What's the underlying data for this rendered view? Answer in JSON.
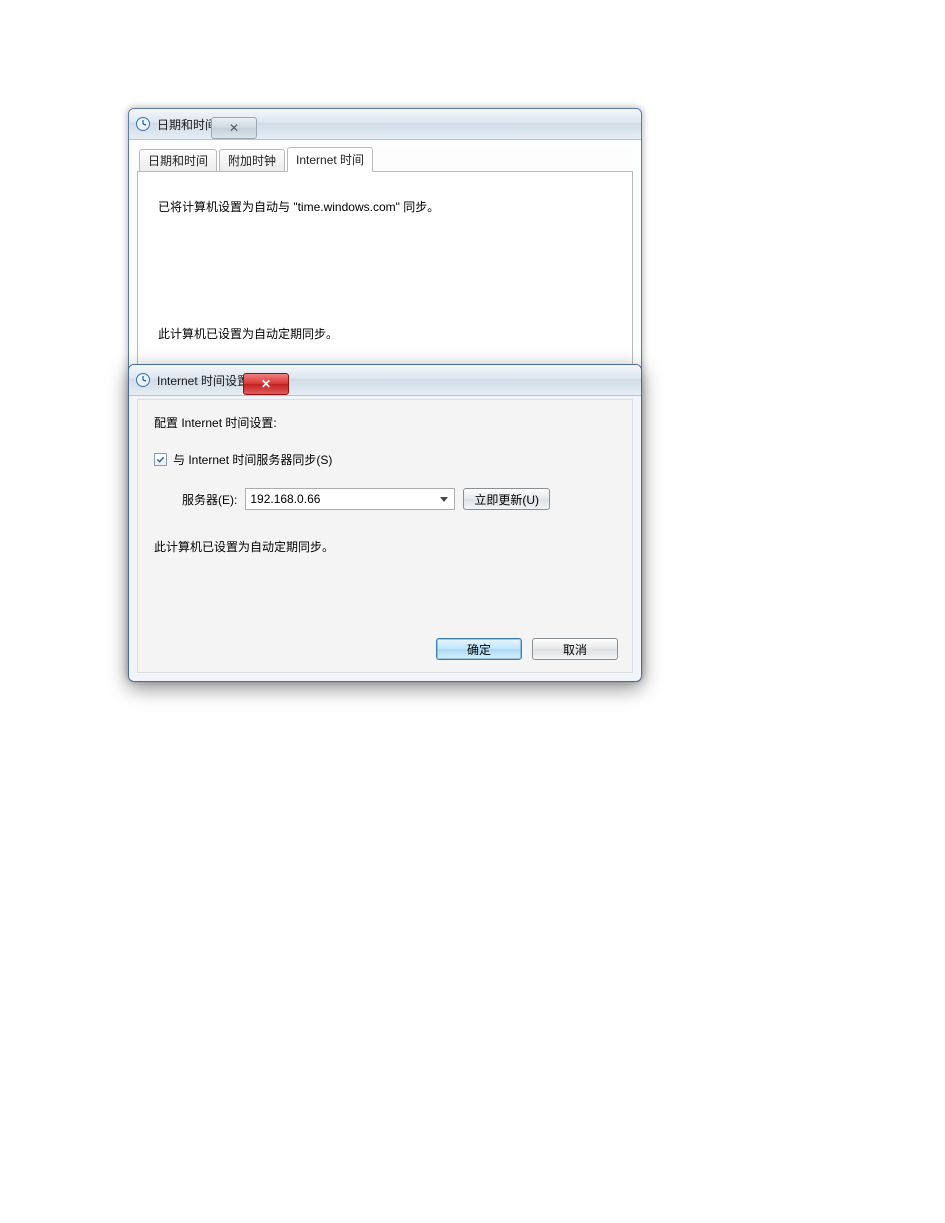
{
  "parent": {
    "title": "日期和时间",
    "close_glyph": "✕",
    "tabs": [
      {
        "label": "日期和时间"
      },
      {
        "label": "附加时钟"
      },
      {
        "label": "Internet 时间"
      }
    ],
    "active_tab_index": 2,
    "panel": {
      "sync_info": "已将计算机设置为自动与 \"time.windows.com\" 同步。",
      "auto_sync_status": "此计算机已设置为自动定期同步。"
    }
  },
  "child": {
    "title": "Internet 时间设置",
    "close_glyph": "✕",
    "config_heading": "配置 Internet 时间设置:",
    "checkbox": {
      "checked": true,
      "label": "与 Internet 时间服务器同步(S)"
    },
    "server": {
      "label": "服务器(E):",
      "value": "192.168.0.66"
    },
    "update_now_label": "立即更新(U)",
    "auto_sync_status": "此计算机已设置为自动定期同步。",
    "ok_label": "确定",
    "cancel_label": "取消"
  },
  "icons": {
    "clock": "clock-icon",
    "close": "close-icon",
    "checkbox_tick": "check-icon",
    "dropdown_caret": "chevron-down-icon"
  }
}
